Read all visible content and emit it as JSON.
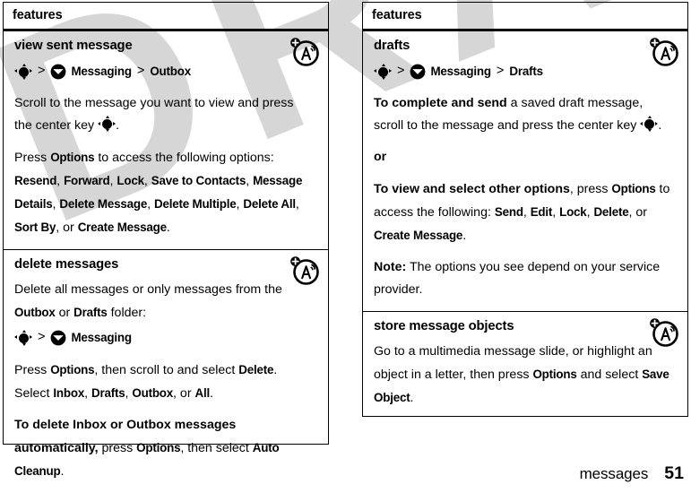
{
  "document": {
    "watermark_text": "DRAFT",
    "watermark_color": "#d6d6d6"
  },
  "footer": {
    "chapter_label": "messages",
    "page_number": "51"
  },
  "icons": {
    "nav_key": "navigation-center-key-icon",
    "envelope": "messaging-envelope-icon",
    "network": "network-service-icon"
  },
  "left_table": {
    "header": "features",
    "sections": [
      {
        "title": "view sent message",
        "has_network_icon": true,
        "path": {
          "key_icon": "nav-key-icon",
          "sep1": ">",
          "menu_icon": "envelope-icon",
          "menu_label": "Messaging",
          "sep2": ">",
          "submenu_label": "Outbox"
        },
        "body": [
          {
            "id": "p1",
            "runs": [
              {
                "t": "Scroll to the message you want to view and press the center key ",
                "s": "plain"
              },
              {
                "t": "NAVKEY",
                "s": "navkey"
              },
              {
                "t": ".",
                "s": "plain"
              }
            ]
          },
          {
            "id": "p2",
            "runs": [
              {
                "t": "Press ",
                "s": "plain"
              },
              {
                "t": "Options",
                "s": "ui"
              },
              {
                "t": " to access the following options: ",
                "s": "plain"
              },
              {
                "t": "Resend",
                "s": "ui"
              },
              {
                "t": ", ",
                "s": "plain"
              },
              {
                "t": "Forward",
                "s": "ui"
              },
              {
                "t": ", ",
                "s": "plain"
              },
              {
                "t": "Lock",
                "s": "ui"
              },
              {
                "t": ", ",
                "s": "plain"
              },
              {
                "t": "Save to Contacts",
                "s": "ui"
              },
              {
                "t": ", ",
                "s": "plain"
              },
              {
                "t": "Message Details",
                "s": "ui"
              },
              {
                "t": ", ",
                "s": "plain"
              },
              {
                "t": "Delete Message",
                "s": "ui"
              },
              {
                "t": ", ",
                "s": "plain"
              },
              {
                "t": "Delete Multiple",
                "s": "ui"
              },
              {
                "t": ", ",
                "s": "plain"
              },
              {
                "t": "Delete All",
                "s": "ui"
              },
              {
                "t": ", ",
                "s": "plain"
              },
              {
                "t": "Sort By",
                "s": "ui"
              },
              {
                "t": ", or ",
                "s": "plain"
              },
              {
                "t": "Create Message",
                "s": "ui"
              },
              {
                "t": ".",
                "s": "plain"
              }
            ]
          }
        ]
      },
      {
        "title": "delete messages",
        "has_network_icon": true,
        "pre_body": [
          {
            "id": "d0",
            "runs": [
              {
                "t": "Delete all messages or only messages from the ",
                "s": "plain"
              },
              {
                "t": "Outbox",
                "s": "ui"
              },
              {
                "t": " or ",
                "s": "plain"
              },
              {
                "t": "Drafts",
                "s": "ui"
              },
              {
                "t": " folder:",
                "s": "plain"
              }
            ]
          }
        ],
        "path": {
          "key_icon": "nav-key-icon",
          "sep1": ">",
          "menu_icon": "envelope-icon",
          "menu_label": "Messaging",
          "sep2": "",
          "submenu_label": ""
        },
        "body": [
          {
            "id": "d1",
            "runs": [
              {
                "t": "Press ",
                "s": "plain"
              },
              {
                "t": "Options",
                "s": "ui"
              },
              {
                "t": ", then scroll to and select ",
                "s": "plain"
              },
              {
                "t": "Delete",
                "s": "ui"
              },
              {
                "t": ". Select ",
                "s": "plain"
              },
              {
                "t": "Inbox",
                "s": "ui"
              },
              {
                "t": ", ",
                "s": "plain"
              },
              {
                "t": "Drafts",
                "s": "ui"
              },
              {
                "t": ", ",
                "s": "plain"
              },
              {
                "t": "Outbox",
                "s": "ui"
              },
              {
                "t": ", or ",
                "s": "plain"
              },
              {
                "t": "All",
                "s": "ui"
              },
              {
                "t": ".",
                "s": "plain"
              }
            ]
          },
          {
            "id": "d2",
            "runs": [
              {
                "t": "To delete Inbox or Outbox messages automatically,",
                "s": "bold"
              },
              {
                "t": " press ",
                "s": "plain"
              },
              {
                "t": "Options",
                "s": "ui"
              },
              {
                "t": ", then select ",
                "s": "plain"
              },
              {
                "t": "Auto Cleanup",
                "s": "ui"
              },
              {
                "t": ".",
                "s": "plain"
              }
            ]
          }
        ]
      }
    ]
  },
  "right_table": {
    "header": "features",
    "sections": [
      {
        "title": "drafts",
        "has_network_icon": true,
        "path": {
          "key_icon": "nav-key-icon",
          "sep1": ">",
          "menu_icon": "envelope-icon",
          "menu_label": "Messaging",
          "sep2": ">",
          "submenu_label": "Drafts"
        },
        "body": [
          {
            "id": "r1",
            "runs": [
              {
                "t": "To complete and send",
                "s": "bold"
              },
              {
                "t": " a saved draft message, scroll to the message and press the center key ",
                "s": "plain"
              },
              {
                "t": "NAVKEY",
                "s": "navkey"
              },
              {
                "t": ".",
                "s": "plain"
              }
            ]
          },
          {
            "id": "r2",
            "runs": [
              {
                "t": "or",
                "s": "bold"
              }
            ]
          },
          {
            "id": "r3",
            "runs": [
              {
                "t": "To view and select other options",
                "s": "bold"
              },
              {
                "t": ", press ",
                "s": "plain"
              },
              {
                "t": "Options",
                "s": "ui"
              },
              {
                "t": " to access the following: ",
                "s": "plain"
              },
              {
                "t": "Send",
                "s": "ui"
              },
              {
                "t": ", ",
                "s": "plain"
              },
              {
                "t": "Edit",
                "s": "ui"
              },
              {
                "t": ", ",
                "s": "plain"
              },
              {
                "t": "Lock",
                "s": "ui"
              },
              {
                "t": ", ",
                "s": "plain"
              },
              {
                "t": "Delete",
                "s": "ui"
              },
              {
                "t": ", or ",
                "s": "plain"
              },
              {
                "t": "Create Message",
                "s": "ui"
              },
              {
                "t": ".",
                "s": "plain"
              }
            ]
          },
          {
            "id": "r4",
            "runs": [
              {
                "t": "Note:",
                "s": "bold"
              },
              {
                "t": " The options you see depend on your service provider.",
                "s": "plain"
              }
            ]
          }
        ]
      },
      {
        "title": "store message objects",
        "has_network_icon": true,
        "body": [
          {
            "id": "s1",
            "runs": [
              {
                "t": "Go to a multimedia message slide, or highlight an object in a letter, then press ",
                "s": "plain"
              },
              {
                "t": "Options",
                "s": "ui"
              },
              {
                "t": " and select ",
                "s": "plain"
              },
              {
                "t": "Save Object",
                "s": "ui"
              },
              {
                "t": ".",
                "s": "plain"
              }
            ]
          }
        ]
      }
    ]
  }
}
